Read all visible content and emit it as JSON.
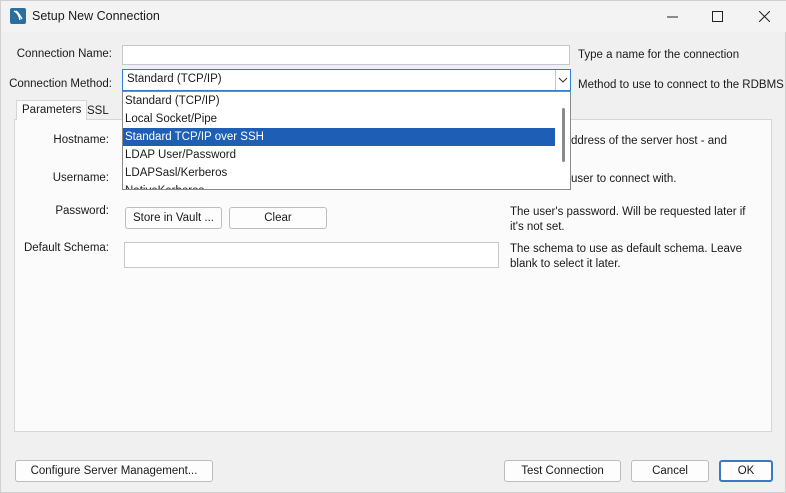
{
  "window": {
    "title": "Setup New Connection"
  },
  "form": {
    "connection_name_label": "Connection Name:",
    "connection_name_value": "",
    "connection_name_hint": "Type a name for the connection",
    "connection_method_label": "Connection Method:",
    "connection_method_value": "Standard (TCP/IP)",
    "connection_method_hint": "Method to use to connect to the RDBMS"
  },
  "tabs": [
    {
      "label": "Parameters",
      "active": true
    },
    {
      "label": "SSL",
      "active": false
    }
  ],
  "dropdown": {
    "options": [
      "Standard (TCP/IP)",
      "Local Socket/Pipe",
      "Standard TCP/IP over SSH",
      "LDAP User/Password",
      "LDAPSasl/Kerberos",
      "NativeKerberos"
    ],
    "highlighted": "Standard TCP/IP over SSH"
  },
  "parameters": {
    "hostname_label": "Hostname:",
    "hostname_hint": "ddress of the server host - and",
    "username_label": "Username:",
    "username_hint": "user to connect with.",
    "password_label": "Password:",
    "store_vault_label": "Store in Vault ...",
    "clear_label": "Clear",
    "password_hint": "The user's password. Will be requested later if it's not set.",
    "default_schema_label": "Default Schema:",
    "default_schema_value": "",
    "default_schema_hint": "The schema to use as default schema. Leave blank to select it later."
  },
  "footer": {
    "configure_label": "Configure Server Management...",
    "test_label": "Test Connection",
    "cancel_label": "Cancel",
    "ok_label": "OK"
  }
}
